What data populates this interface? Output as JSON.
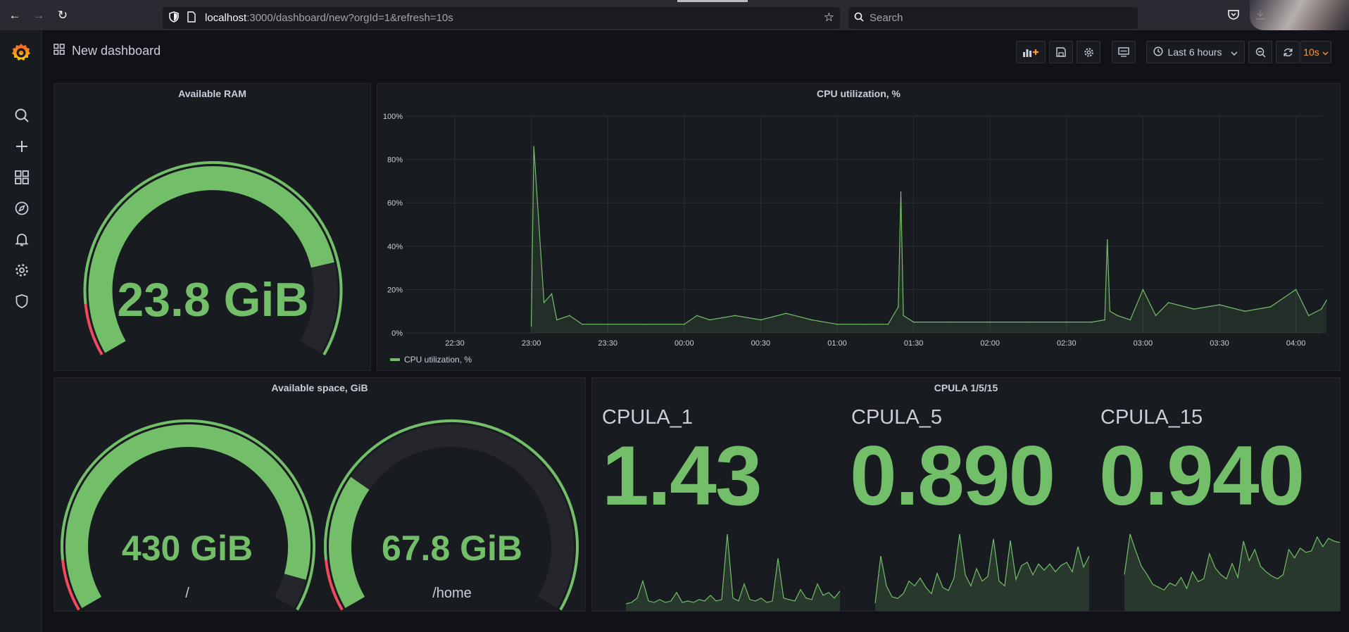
{
  "browser": {
    "url_host": "localhost",
    "url_path": ":3000/dashboard/new?orgId=1&refresh=10s",
    "search_placeholder": "Search"
  },
  "header": {
    "title": "New dashboard",
    "time_range": "Last 6 hours",
    "refresh_interval": "10s"
  },
  "panels": {
    "ram": {
      "title": "Available RAM",
      "value": "23.8 GiB",
      "fill_fraction": 0.82
    },
    "cpu": {
      "title": "CPU utilization, %",
      "legend": "CPU utilization, %"
    },
    "disk": {
      "title": "Available space, GiB",
      "gauges": [
        {
          "value": "430 GiB",
          "label": "/",
          "fill_fraction": 0.94
        },
        {
          "value": "67.8 GiB",
          "label": "/home",
          "fill_fraction": 0.27
        }
      ]
    },
    "cpula": {
      "title": "CPULA 1/5/15",
      "stats": [
        {
          "name": "CPULA_1",
          "value": "1.43"
        },
        {
          "name": "CPULA_5",
          "value": "0.890"
        },
        {
          "name": "CPULA_15",
          "value": "0.940"
        }
      ]
    }
  },
  "colors": {
    "green": "#73bf69",
    "red": "#f2495c",
    "orange": "#ff9830",
    "track": "#25262b"
  },
  "chart_data": {
    "type": "line",
    "title": "CPU utilization, %",
    "x_ticks": [
      "22:30",
      "23:00",
      "23:30",
      "00:00",
      "00:30",
      "01:00",
      "01:30",
      "02:00",
      "02:30",
      "03:00",
      "03:30",
      "04:00"
    ],
    "y_ticks": [
      "0%",
      "20%",
      "40%",
      "60%",
      "80%",
      "100%"
    ],
    "ylim": [
      0,
      100
    ],
    "grid": true,
    "legend_position": "bottom-left",
    "series": [
      {
        "name": "CPU utilization, %",
        "x": [
          "23:00",
          "23:01",
          "23:05",
          "23:08",
          "23:10",
          "23:15",
          "23:20",
          "23:30",
          "23:45",
          "00:00",
          "00:05",
          "00:10",
          "00:20",
          "00:30",
          "00:40",
          "00:50",
          "01:00",
          "01:10",
          "01:20",
          "01:24",
          "01:25",
          "01:26",
          "01:30",
          "01:45",
          "02:00",
          "02:15",
          "02:30",
          "02:40",
          "02:45",
          "02:46",
          "02:47",
          "02:50",
          "02:55",
          "03:00",
          "03:05",
          "03:10",
          "03:20",
          "03:30",
          "03:40",
          "03:50",
          "04:00",
          "04:05",
          "04:10",
          "04:12"
        ],
        "values": [
          3,
          86,
          14,
          18,
          6,
          8,
          4,
          4,
          4,
          4,
          8,
          6,
          8,
          6,
          9,
          6,
          4,
          4,
          4,
          12,
          65,
          8,
          5,
          5,
          5,
          5,
          5,
          5,
          6,
          43,
          10,
          8,
          6,
          20,
          8,
          14,
          11,
          13,
          10,
          12,
          20,
          8,
          11,
          15
        ]
      }
    ]
  },
  "sparklines": {
    "cpula_1": [
      0.5,
      0.6,
      0.9,
      2.1,
      0.7,
      0.6,
      0.8,
      0.6,
      0.7,
      1.3,
      0.6,
      0.7,
      0.6,
      0.8,
      0.7,
      1.1,
      0.7,
      0.8,
      5.4,
      0.9,
      0.7,
      1.9,
      0.8,
      0.7,
      0.9,
      0.6,
      0.7,
      3.7,
      0.9,
      0.8,
      0.7,
      1.5,
      0.9,
      0.8,
      1.9,
      1.1,
      1.3,
      0.9,
      1.4
    ],
    "cpula_5": [
      0.5,
      3.5,
      1.6,
      0.9,
      0.8,
      1.1,
      1.9,
      1.6,
      2.1,
      1.5,
      1.1,
      2.4,
      1.5,
      1.3,
      2.1,
      4.9,
      2.3,
      1.6,
      2.7,
      1.9,
      2.2,
      4.6,
      1.9,
      1.6,
      4.5,
      2.0,
      2.9,
      3.1,
      2.3,
      3.0,
      2.6,
      3.0,
      2.5,
      2.9,
      3.1,
      2.5,
      4.1,
      2.8,
      3.5
    ],
    "cpula_15": [
      2.6,
      5.5,
      4.3,
      3.2,
      2.6,
      1.9,
      1.7,
      1.5,
      2.0,
      1.8,
      2.4,
      1.6,
      2.8,
      2.1,
      2.3,
      4.1,
      3.1,
      2.6,
      2.3,
      3.4,
      2.4,
      5.0,
      3.6,
      4.4,
      3.2,
      2.8,
      2.5,
      2.3,
      2.6,
      4.4,
      3.8,
      4.5,
      4.2,
      4.3,
      5.3,
      4.6,
      5.2,
      5.0,
      4.9
    ]
  }
}
